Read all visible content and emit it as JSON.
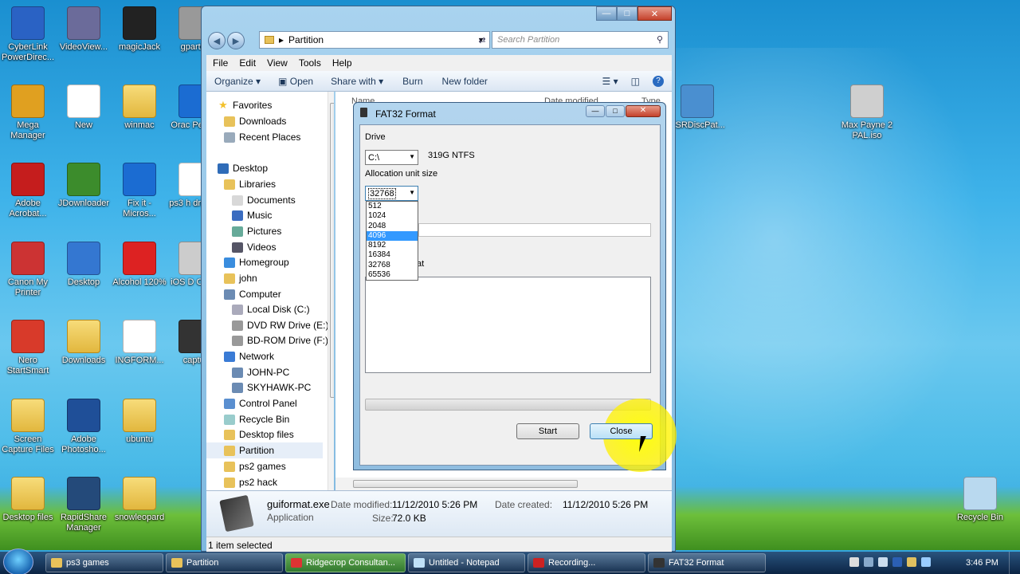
{
  "desktop_icons": [
    {
      "label": "CyberLink PowerDirec...",
      "icon": "cyberlink-icon"
    },
    {
      "label": "VideoView...",
      "icon": "videoview-icon"
    },
    {
      "label": "magicJack",
      "icon": "magicjack-icon"
    },
    {
      "label": "gpartec",
      "icon": "gpartec-icon"
    },
    {
      "label": "Mega Manager",
      "icon": "mega-icon"
    },
    {
      "label": "New",
      "icon": "document-icon"
    },
    {
      "label": "winmac",
      "icon": "folder-icon"
    },
    {
      "label": "Orac People",
      "icon": "ie-icon"
    },
    {
      "label": "Adobe Acrobat...",
      "icon": "acrobat-icon"
    },
    {
      "label": "JDownloader",
      "icon": "jdownloader-icon"
    },
    {
      "label": "Fix it - Micros...",
      "icon": "ie-icon"
    },
    {
      "label": "ps3 h drive in",
      "icon": "document-icon"
    },
    {
      "label": "Canon My Printer",
      "icon": "printer-icon"
    },
    {
      "label": "Desktop",
      "icon": "monitor-icon"
    },
    {
      "label": "Alcohol 120%",
      "icon": "alcohol-icon"
    },
    {
      "label": "iOS D Cente",
      "icon": "ios-icon"
    },
    {
      "label": "Nero StartSmart",
      "icon": "nero-icon"
    },
    {
      "label": "Downloads",
      "icon": "folder-icon"
    },
    {
      "label": "INGFORM...",
      "icon": "pdf-icon"
    },
    {
      "label": "captur",
      "icon": "film-icon"
    },
    {
      "label": "Screen Capture Files",
      "icon": "folder-icon"
    },
    {
      "label": "Adobe Photosho...",
      "icon": "photoshop-icon"
    },
    {
      "label": "ubuntu",
      "icon": "folder-icon"
    },
    {
      "label": "Desktop files",
      "icon": "folder-icon"
    },
    {
      "label": "RapidShare Manager",
      "icon": "rapidshare-icon"
    },
    {
      "label": "snowleopard",
      "icon": "folder-icon"
    },
    {
      "label": "ESRDiscPat...",
      "icon": "setup-icon"
    },
    {
      "label": "Max Payne 2 PAL.iso",
      "icon": "disc-icon"
    },
    {
      "label": "Recycle Bin",
      "icon": "recycle-bin-icon"
    }
  ],
  "explorer": {
    "address": "Partition",
    "search_placeholder": "Search Partition",
    "menu": [
      "File",
      "Edit",
      "View",
      "Tools",
      "Help"
    ],
    "toolbar": [
      "Organize",
      "Open",
      "Share with",
      "Burn",
      "New folder"
    ],
    "nav": [
      {
        "label": "Favorites",
        "icon": "star-icon"
      },
      {
        "label": "Downloads",
        "icon": "folder-icon"
      },
      {
        "label": "Recent Places",
        "icon": "recent-icon"
      },
      {
        "label": "Desktop",
        "icon": "desktop-icon"
      },
      {
        "label": "Libraries",
        "icon": "library-icon"
      },
      {
        "label": "Documents",
        "icon": "documents-icon"
      },
      {
        "label": "Music",
        "icon": "music-icon"
      },
      {
        "label": "Pictures",
        "icon": "pictures-icon"
      },
      {
        "label": "Videos",
        "icon": "videos-icon"
      },
      {
        "label": "Homegroup",
        "icon": "homegroup-icon"
      },
      {
        "label": "john",
        "icon": "user-folder-icon"
      },
      {
        "label": "Computer",
        "icon": "computer-icon"
      },
      {
        "label": "Local Disk (C:)",
        "icon": "drive-icon"
      },
      {
        "label": "DVD RW Drive (E:)",
        "icon": "dvd-icon"
      },
      {
        "label": "BD-ROM Drive (F:)",
        "icon": "dvd-icon"
      },
      {
        "label": "Network",
        "icon": "network-icon"
      },
      {
        "label": "JOHN-PC",
        "icon": "pc-icon"
      },
      {
        "label": "SKYHAWK-PC",
        "icon": "pc-icon"
      },
      {
        "label": "Control Panel",
        "icon": "control-panel-icon"
      },
      {
        "label": "Recycle Bin",
        "icon": "recycle-bin-icon"
      },
      {
        "label": "Desktop files",
        "icon": "folder-icon"
      },
      {
        "label": "Partition",
        "icon": "folder-icon"
      },
      {
        "label": "ps2 games",
        "icon": "folder-icon"
      },
      {
        "label": "ps2 hack",
        "icon": "folder-icon"
      }
    ],
    "column_hints": [
      "Name",
      "Date modified",
      "Type"
    ],
    "details": {
      "filename": "guiformat.exe",
      "filetype": "Application",
      "modified_label": "Date modified:",
      "modified": "11/12/2010 5:26 PM",
      "created_label": "Date created:",
      "created": "11/12/2010 5:26 PM",
      "size_label": "Size:",
      "size": "72.0 KB"
    },
    "status": "1 item selected"
  },
  "dialog": {
    "title": "FAT32 Format",
    "drive_label": "Drive",
    "drive_value": "C:\\",
    "drive_info": "319G NTFS",
    "alloc_label": "Allocation unit size",
    "alloc_value": "32768",
    "alloc_options": [
      "512",
      "1024",
      "2048",
      "4096",
      "8192",
      "16384",
      "32768",
      "65536"
    ],
    "alloc_highlighted": "4096",
    "partial_text": "at",
    "start": "Start",
    "close": "Close"
  },
  "taskbar": {
    "buttons": [
      {
        "label": "ps3 games",
        "icon": "folder-icon"
      },
      {
        "label": "Partition",
        "icon": "folder-icon"
      },
      {
        "label": "Ridgecrop Consultan...",
        "icon": "chrome-icon"
      },
      {
        "label": "Untitled - Notepad",
        "icon": "notepad-icon"
      },
      {
        "label": "Recording...",
        "icon": "record-icon"
      },
      {
        "label": "FAT32 Format",
        "icon": "fat32-icon"
      }
    ],
    "time": "3:46 PM"
  }
}
